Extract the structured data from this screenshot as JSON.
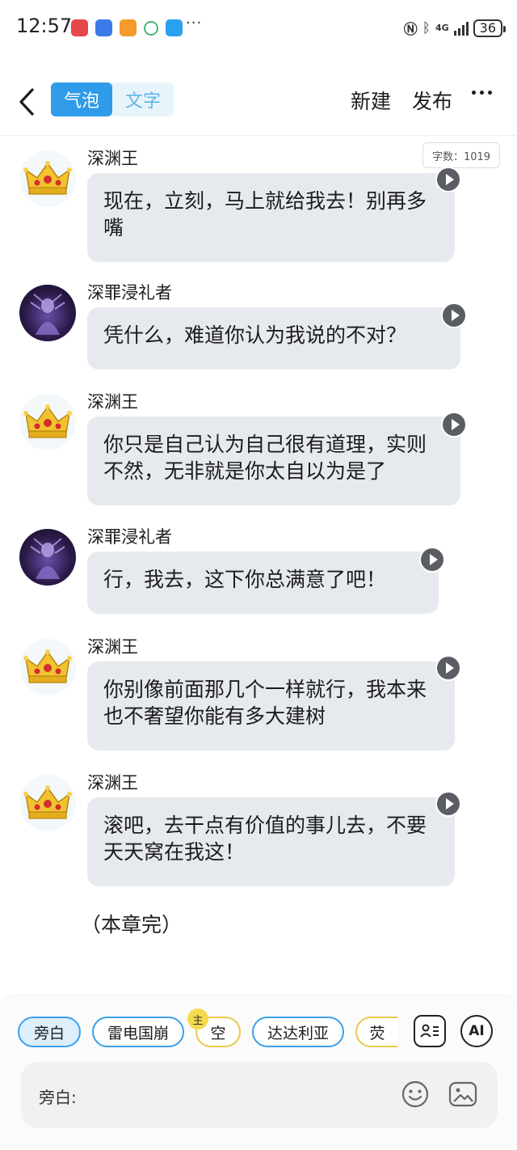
{
  "status_bar": {
    "time": "12:57",
    "dots": "···",
    "network": "4G",
    "battery": "36"
  },
  "header": {
    "back_icon": "back-arrow-icon",
    "tabs": [
      {
        "label": "气泡",
        "active": true
      },
      {
        "label": "文字",
        "active": false
      }
    ],
    "new_label": "新建",
    "publish_label": "发布",
    "more_icon": "more-icon"
  },
  "word_count": "字数：1019",
  "messages": [
    {
      "sender": "深渊王",
      "avatar": "crown",
      "text": "现在，立刻，马上就给我去！别再多嘴"
    },
    {
      "sender": "深罪浸礼者",
      "avatar": "dark-figure",
      "text": "凭什么，难道你认为我说的不对？"
    },
    {
      "sender": "深渊王",
      "avatar": "crown",
      "text": "你只是自己认为自己很有道理，实则不然，无非就是你太自以为是了"
    },
    {
      "sender": "深罪浸礼者",
      "avatar": "dark-figure",
      "text": "行，我去，这下你总满意了吧！"
    },
    {
      "sender": "深渊王",
      "avatar": "crown",
      "text": "你别像前面那几个一样就行，我本来也不奢望你能有多大建树"
    },
    {
      "sender": "深渊王",
      "avatar": "crown",
      "text": "滚吧，去干点有价值的事儿去，不要天天窝在我这！"
    }
  ],
  "chapter_end": "（本章完）",
  "bottom": {
    "chips": [
      "旁白",
      "雷电国崩",
      "空",
      "达达利亚",
      "荧"
    ],
    "main_badge": "主",
    "ai_label": "AI",
    "input_label": "旁白:",
    "input_value": ""
  }
}
